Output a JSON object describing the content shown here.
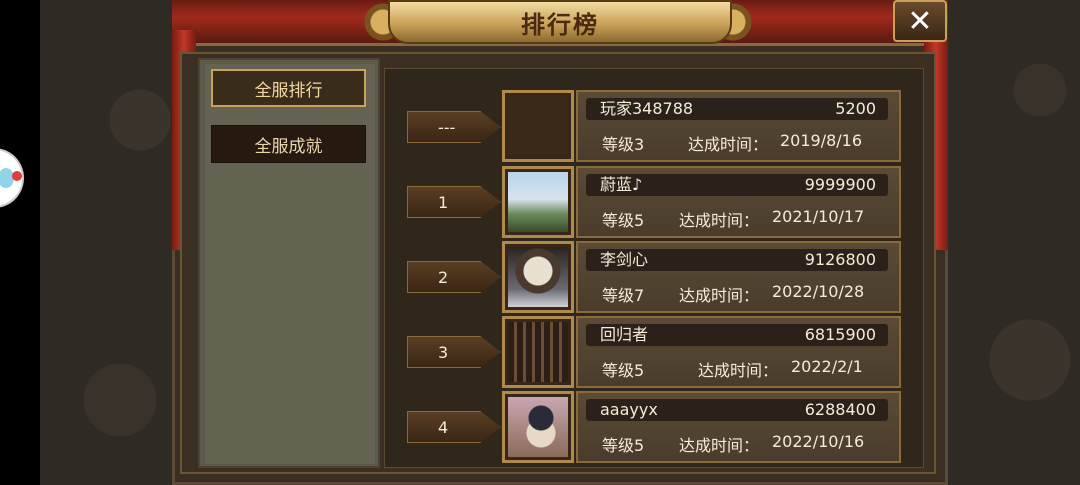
{
  "title": "排行榜",
  "close_label": "✕",
  "tabs": [
    {
      "label": "全服排行",
      "active": true
    },
    {
      "label": "全服成就",
      "active": false
    }
  ],
  "rows": [
    {
      "rank": "---",
      "name": "玩家348788",
      "score": "5200",
      "level": "等级3",
      "time_label": "达成时间：",
      "time": "2019/8/16",
      "avatar": "empty-avatar"
    },
    {
      "rank": "1",
      "name": "蔚蓝♪",
      "score": "9999900",
      "level": "等级5",
      "time_label": "达成时间：",
      "time": "2021/10/17",
      "avatar": "sky-tower-avatar"
    },
    {
      "rank": "2",
      "name": "李剑心",
      "score": "9126800",
      "level": "等级7",
      "time_label": "达成时间：",
      "time": "2022/10/28",
      "avatar": "warrior-avatar"
    },
    {
      "rank": "3",
      "name": "回归者",
      "score": "6815900",
      "level": "等级5",
      "time_label": "达成时间：",
      "time": "2022/2/1",
      "avatar": "hall-avatar"
    },
    {
      "rank": "4",
      "name": "aaayyx",
      "score": "6288400",
      "level": "等级5",
      "time_label": "达成时间：",
      "time": "2022/10/16",
      "avatar": "anime-avatar"
    }
  ]
}
